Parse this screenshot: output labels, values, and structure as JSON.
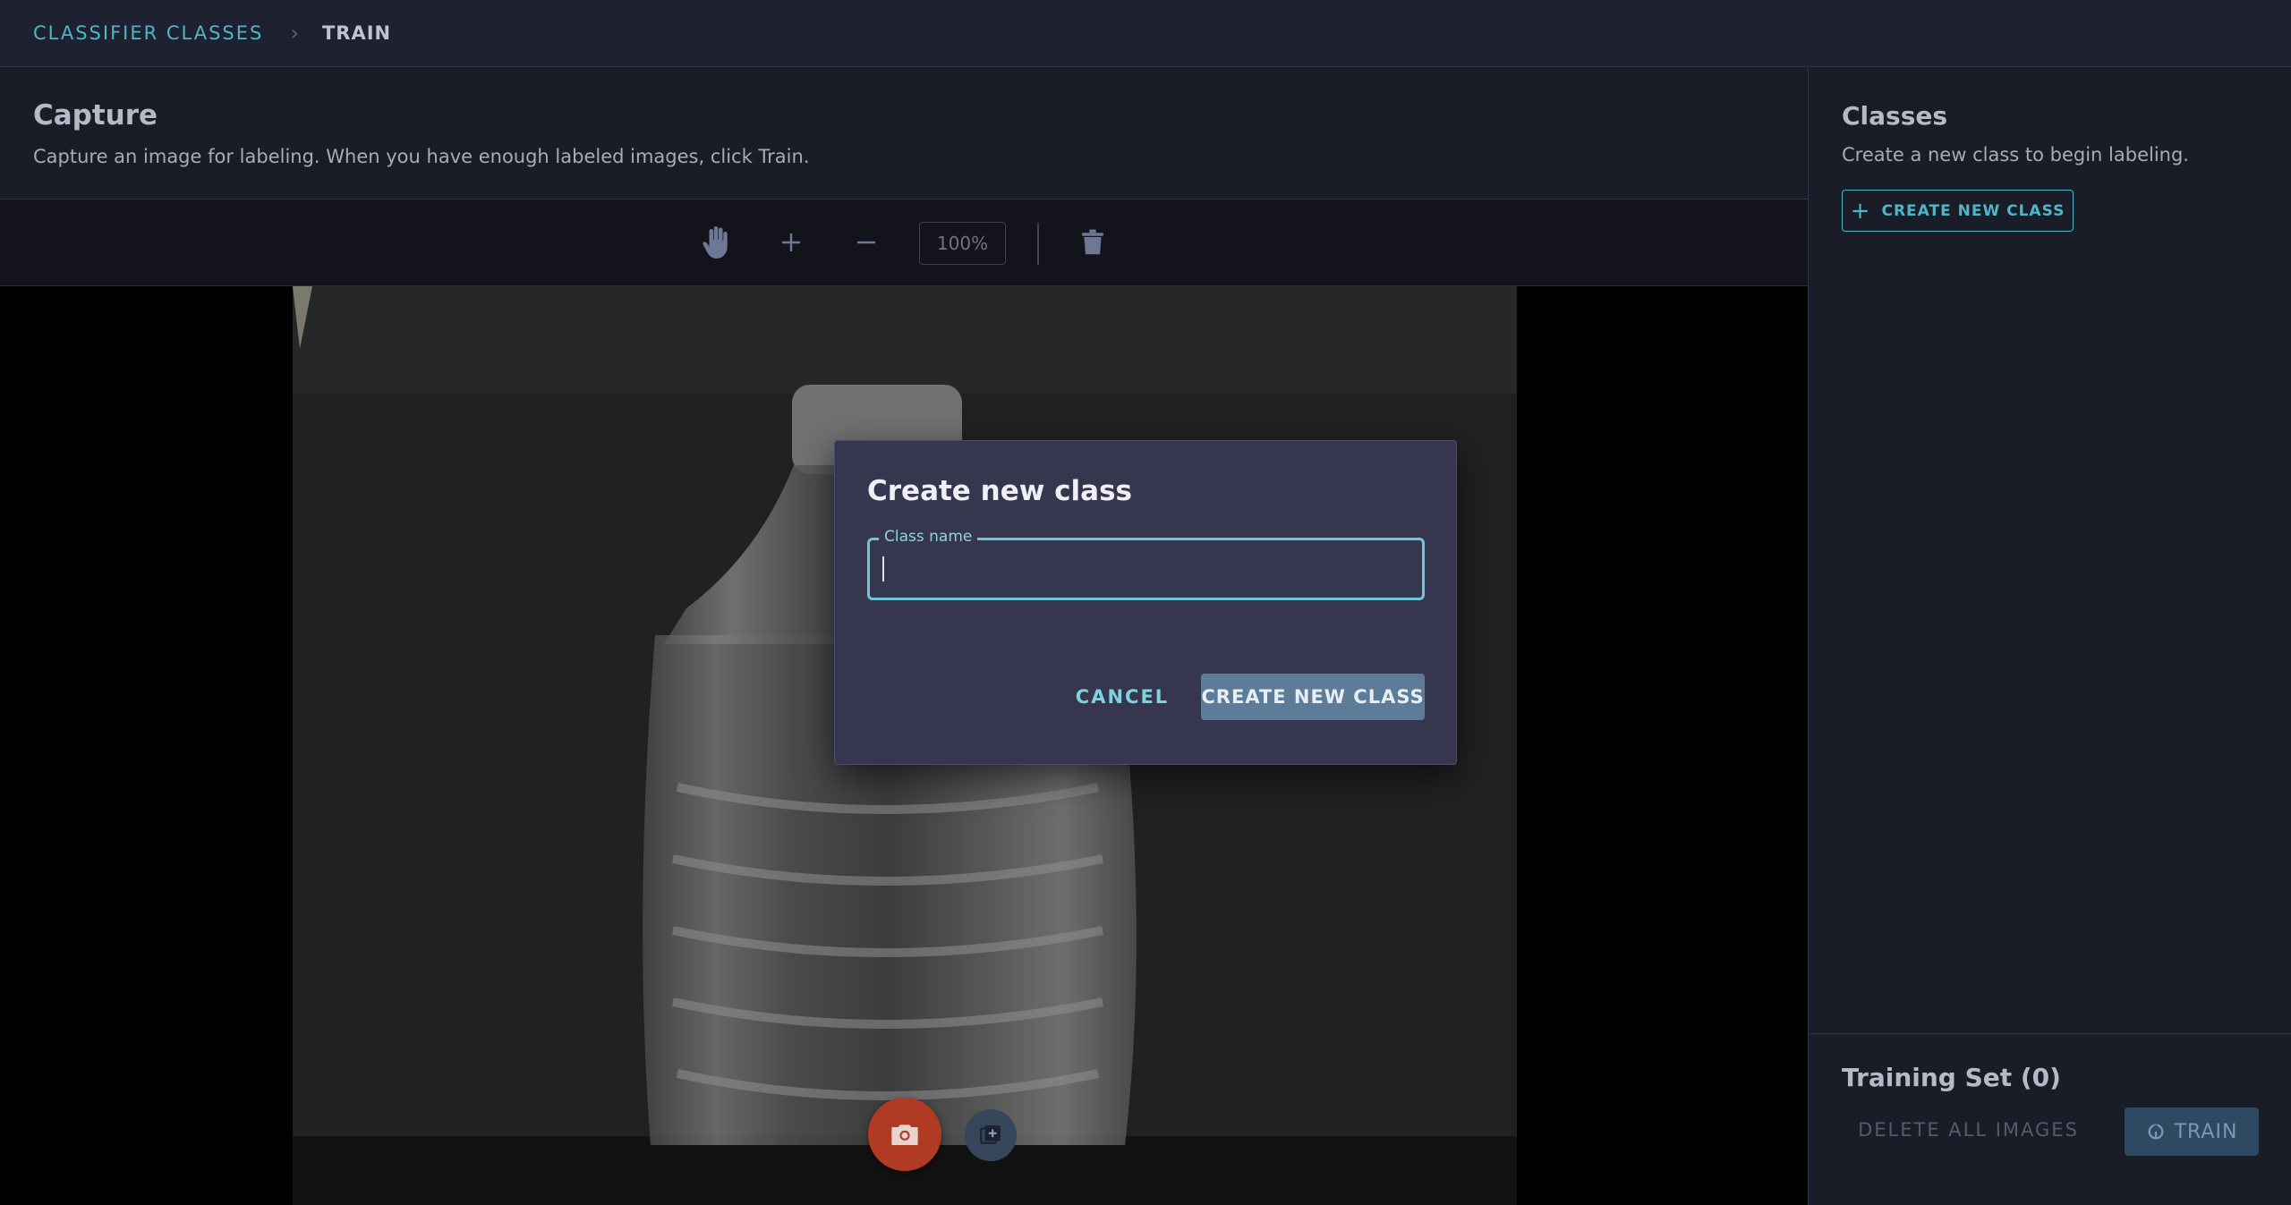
{
  "breadcrumb": {
    "parent": "CLASSIFIER CLASSES",
    "current": "TRAIN"
  },
  "capture": {
    "title": "Capture",
    "description": "Capture an image for labeling. When you have enough labeled images, click Train."
  },
  "toolbar": {
    "tools": [
      "hand-icon",
      "zoom-in-icon",
      "zoom-out-icon",
      "trash-icon"
    ],
    "zoom": "100%"
  },
  "classes_panel": {
    "title": "Classes",
    "description": "Create a new class to begin labeling.",
    "create_button": "CREATE NEW CLASS"
  },
  "training_set": {
    "title": "Training Set (0)",
    "delete_all": "DELETE ALL IMAGES",
    "train": "TRAIN"
  },
  "dialog": {
    "title": "Create new class",
    "field_label": "Class name",
    "field_value": "",
    "cancel": "CANCEL",
    "confirm": "CREATE NEW CLASS"
  },
  "colors": {
    "accent": "#4db6c7",
    "capture_button": "#b03a22",
    "dialog_bg": "#36374f"
  }
}
